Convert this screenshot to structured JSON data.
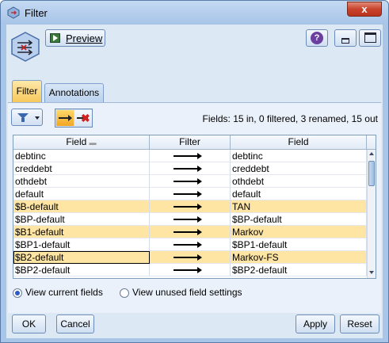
{
  "window": {
    "title": "Filter",
    "close_label": "x"
  },
  "toolbar": {
    "preview_label": "Preview",
    "help_label": "?"
  },
  "tabs": [
    {
      "label": "Filter",
      "active": true
    },
    {
      "label": "Annotations",
      "active": false
    }
  ],
  "summary": "Fields: 15 in, 0 filtered, 3 renamed, 15 out",
  "table": {
    "headers": [
      "Field",
      "Filter",
      "Field"
    ],
    "rows": [
      {
        "input": "debtinc",
        "output": "debtinc"
      },
      {
        "input": "creddebt",
        "output": "creddebt"
      },
      {
        "input": "othdebt",
        "output": "othdebt"
      },
      {
        "input": "default",
        "output": "default"
      },
      {
        "input": "$B-default",
        "output": "TAN"
      },
      {
        "input": "$BP-default",
        "output": "$BP-default"
      },
      {
        "input": "$B1-default",
        "output": "Markov"
      },
      {
        "input": "$BP1-default",
        "output": "$BP1-default"
      },
      {
        "input": "$B2-default",
        "output": "Markov-FS"
      },
      {
        "input": "$BP2-default",
        "output": "$BP2-default"
      }
    ]
  },
  "view_options": {
    "current": "View current fields",
    "unused": "View unused field settings"
  },
  "buttons": {
    "ok": "OK",
    "cancel": "Cancel",
    "apply": "Apply",
    "reset": "Reset"
  },
  "colors": {
    "highlight": "#ffe5a3",
    "accent_tab": "#f7c85c"
  }
}
